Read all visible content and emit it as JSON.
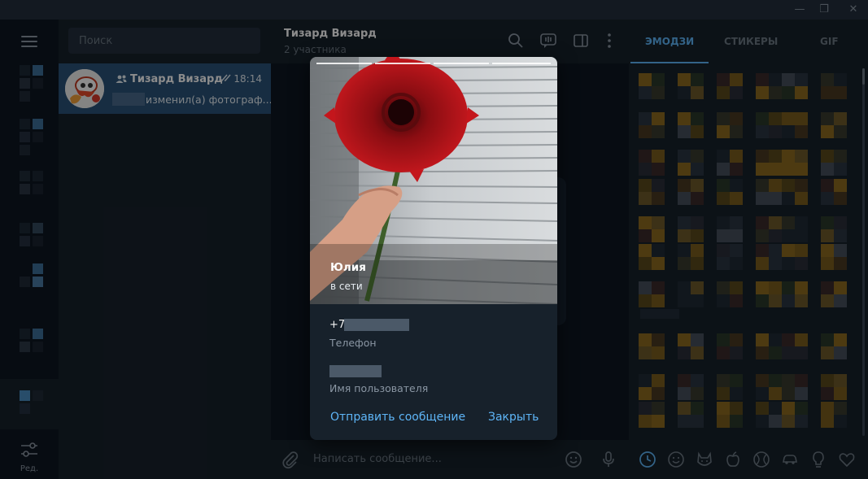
{
  "window": {
    "controls": [
      "—",
      "❐",
      "✕"
    ]
  },
  "chat_list": {
    "search_placeholder": "Поиск",
    "items": [
      {
        "name": "Тизард Визард",
        "time": "18:14",
        "preview": "изменил(а) фотограф..."
      }
    ]
  },
  "rail": {
    "edit_label": "Ред."
  },
  "chat": {
    "title": "Тизард Визард",
    "subtitle": "2 участника",
    "composer_placeholder": "Написать сообщение..."
  },
  "profile": {
    "name": "Юлия",
    "status": "в сети",
    "phone_prefix": "+7",
    "phone_label": "Телефон",
    "username_label": "Имя пользователя",
    "send_button": "Отправить сообщение",
    "close_button": "Закрыть"
  },
  "panel": {
    "tabs": [
      "ЭМОДЗИ",
      "СТИКЕРЫ",
      "GIF"
    ],
    "active_tab": "ЭМОДЗИ"
  },
  "colors": {
    "accent": "#5eb5f7",
    "selected_row": "#2b5278",
    "sidebar_bg": "#17212b",
    "chat_bg": "#0e1621"
  },
  "icons": {
    "hamburger": "menu-icon",
    "filters": "filters-icon",
    "search": "search-icon",
    "voice_chat": "voice-chat-icon",
    "side_panel": "side-panel-icon",
    "more": "more-icon",
    "attach": "attach-icon",
    "emoji": "emoji-icon",
    "mic": "microphone-icon"
  }
}
